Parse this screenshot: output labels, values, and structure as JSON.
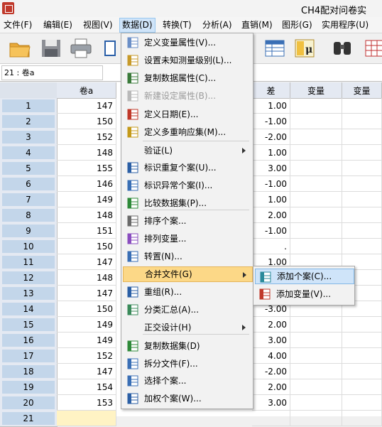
{
  "window": {
    "title": "CH4配对问卷实"
  },
  "menubar": [
    {
      "label": "文件(F)",
      "active": false
    },
    {
      "label": "编辑(E)",
      "active": false
    },
    {
      "label": "视图(V)",
      "active": false
    },
    {
      "label": "数据(D)",
      "active": true
    },
    {
      "label": "转换(T)",
      "active": false
    },
    {
      "label": "分析(A)",
      "active": false
    },
    {
      "label": "直销(M)",
      "active": false
    },
    {
      "label": "图形(G)",
      "active": false
    },
    {
      "label": "实用程序(U)",
      "active": false
    }
  ],
  "toolbar": {
    "icons": [
      "open-folder-icon",
      "save-icon",
      "print-icon",
      "dialog-recall-icon",
      "insert-cases-icon",
      "value-labels-icon",
      "find-icon",
      "split-file-icon"
    ]
  },
  "cell_editor": {
    "reference": "21 : 卷a"
  },
  "grid": {
    "columns": [
      "卷a",
      "差",
      "变量",
      "变量"
    ],
    "rows": [
      {
        "num": "1",
        "a": "147",
        "diff": "1.00"
      },
      {
        "num": "2",
        "a": "150",
        "diff": "-1.00"
      },
      {
        "num": "3",
        "a": "152",
        "diff": "-2.00"
      },
      {
        "num": "4",
        "a": "148",
        "diff": "1.00"
      },
      {
        "num": "5",
        "a": "155",
        "diff": "3.00"
      },
      {
        "num": "6",
        "a": "146",
        "diff": "-1.00"
      },
      {
        "num": "7",
        "a": "149",
        "diff": "1.00"
      },
      {
        "num": "8",
        "a": "148",
        "diff": "2.00"
      },
      {
        "num": "9",
        "a": "151",
        "diff": "-1.00"
      },
      {
        "num": "10",
        "a": "150",
        "diff": "."
      },
      {
        "num": "11",
        "a": "147",
        "diff": "1.00"
      },
      {
        "num": "12",
        "a": "148",
        "diff": "1.00"
      },
      {
        "num": "13",
        "a": "147",
        "diff": "1.00"
      },
      {
        "num": "14",
        "a": "150",
        "diff": "-3.00"
      },
      {
        "num": "15",
        "a": "149",
        "diff": "2.00"
      },
      {
        "num": "16",
        "a": "149",
        "diff": "3.00"
      },
      {
        "num": "17",
        "a": "152",
        "diff": "4.00"
      },
      {
        "num": "18",
        "a": "147",
        "diff": "-2.00"
      },
      {
        "num": "19",
        "a": "154",
        "diff": "2.00"
      },
      {
        "num": "20",
        "a": "153",
        "diff": "3.00"
      },
      {
        "num": "21",
        "a": "",
        "diff": ""
      }
    ]
  },
  "data_menu": {
    "items": [
      {
        "label": "定义变量属性(V)...",
        "icon": "define-variable-properties-icon",
        "disabled": false,
        "submenu": false,
        "highlight": false
      },
      {
        "label": "设置未知测量级别(L)...",
        "icon": "set-measurement-level-icon",
        "disabled": false,
        "submenu": false,
        "highlight": false
      },
      {
        "label": "复制数据属性(C)...",
        "icon": "copy-data-properties-icon",
        "disabled": false,
        "submenu": false,
        "highlight": false
      },
      {
        "label": "新建设定属性(B)...",
        "icon": "new-custom-attribute-icon",
        "disabled": true,
        "submenu": false,
        "highlight": false
      },
      {
        "label": "定义日期(E)...",
        "icon": "define-dates-icon",
        "disabled": false,
        "submenu": false,
        "highlight": false
      },
      {
        "label": "定义多重响应集(M)...",
        "icon": "multiple-response-icon",
        "disabled": false,
        "submenu": false,
        "highlight": false
      },
      {
        "label": "验证(L)",
        "icon": "",
        "disabled": false,
        "submenu": true,
        "highlight": false
      },
      {
        "label": "标识重复个案(U)...",
        "icon": "duplicate-cases-icon",
        "disabled": false,
        "submenu": false,
        "highlight": false
      },
      {
        "label": "标识异常个案(I)...",
        "icon": "unusual-cases-icon",
        "disabled": false,
        "submenu": false,
        "highlight": false
      },
      {
        "label": "比较数据集(P)...",
        "icon": "compare-datasets-icon",
        "disabled": false,
        "submenu": false,
        "highlight": false
      },
      {
        "label": "排序个案...",
        "icon": "sort-cases-icon",
        "disabled": false,
        "submenu": false,
        "highlight": false
      },
      {
        "label": "排列变量...",
        "icon": "sort-variables-icon",
        "disabled": false,
        "submenu": false,
        "highlight": false
      },
      {
        "label": "转置(N)...",
        "icon": "transpose-icon",
        "disabled": false,
        "submenu": false,
        "highlight": false
      },
      {
        "label": "合并文件(G)",
        "icon": "",
        "disabled": false,
        "submenu": true,
        "highlight": true
      },
      {
        "label": "重组(R)...",
        "icon": "restructure-icon",
        "disabled": false,
        "submenu": false,
        "highlight": false
      },
      {
        "label": "分类汇总(A)...",
        "icon": "aggregate-icon",
        "disabled": false,
        "submenu": false,
        "highlight": false
      },
      {
        "label": "正交设计(H)",
        "icon": "",
        "disabled": false,
        "submenu": true,
        "highlight": false
      },
      {
        "label": "复制数据集(D)",
        "icon": "copy-dataset-icon",
        "disabled": false,
        "submenu": false,
        "highlight": false
      },
      {
        "label": "拆分文件(F)...",
        "icon": "split-file-icon",
        "disabled": false,
        "submenu": false,
        "highlight": false
      },
      {
        "label": "选择个案...",
        "icon": "select-cases-icon",
        "disabled": false,
        "submenu": false,
        "highlight": false
      },
      {
        "label": "加权个案(W)...",
        "icon": "weight-cases-icon",
        "disabled": false,
        "submenu": false,
        "highlight": false
      }
    ]
  },
  "merge_submenu": {
    "items": [
      {
        "label": "添加个案(C)...",
        "icon": "add-cases-icon",
        "highlight": true
      },
      {
        "label": "添加变量(V)...",
        "icon": "add-variables-icon",
        "highlight": false
      }
    ]
  }
}
